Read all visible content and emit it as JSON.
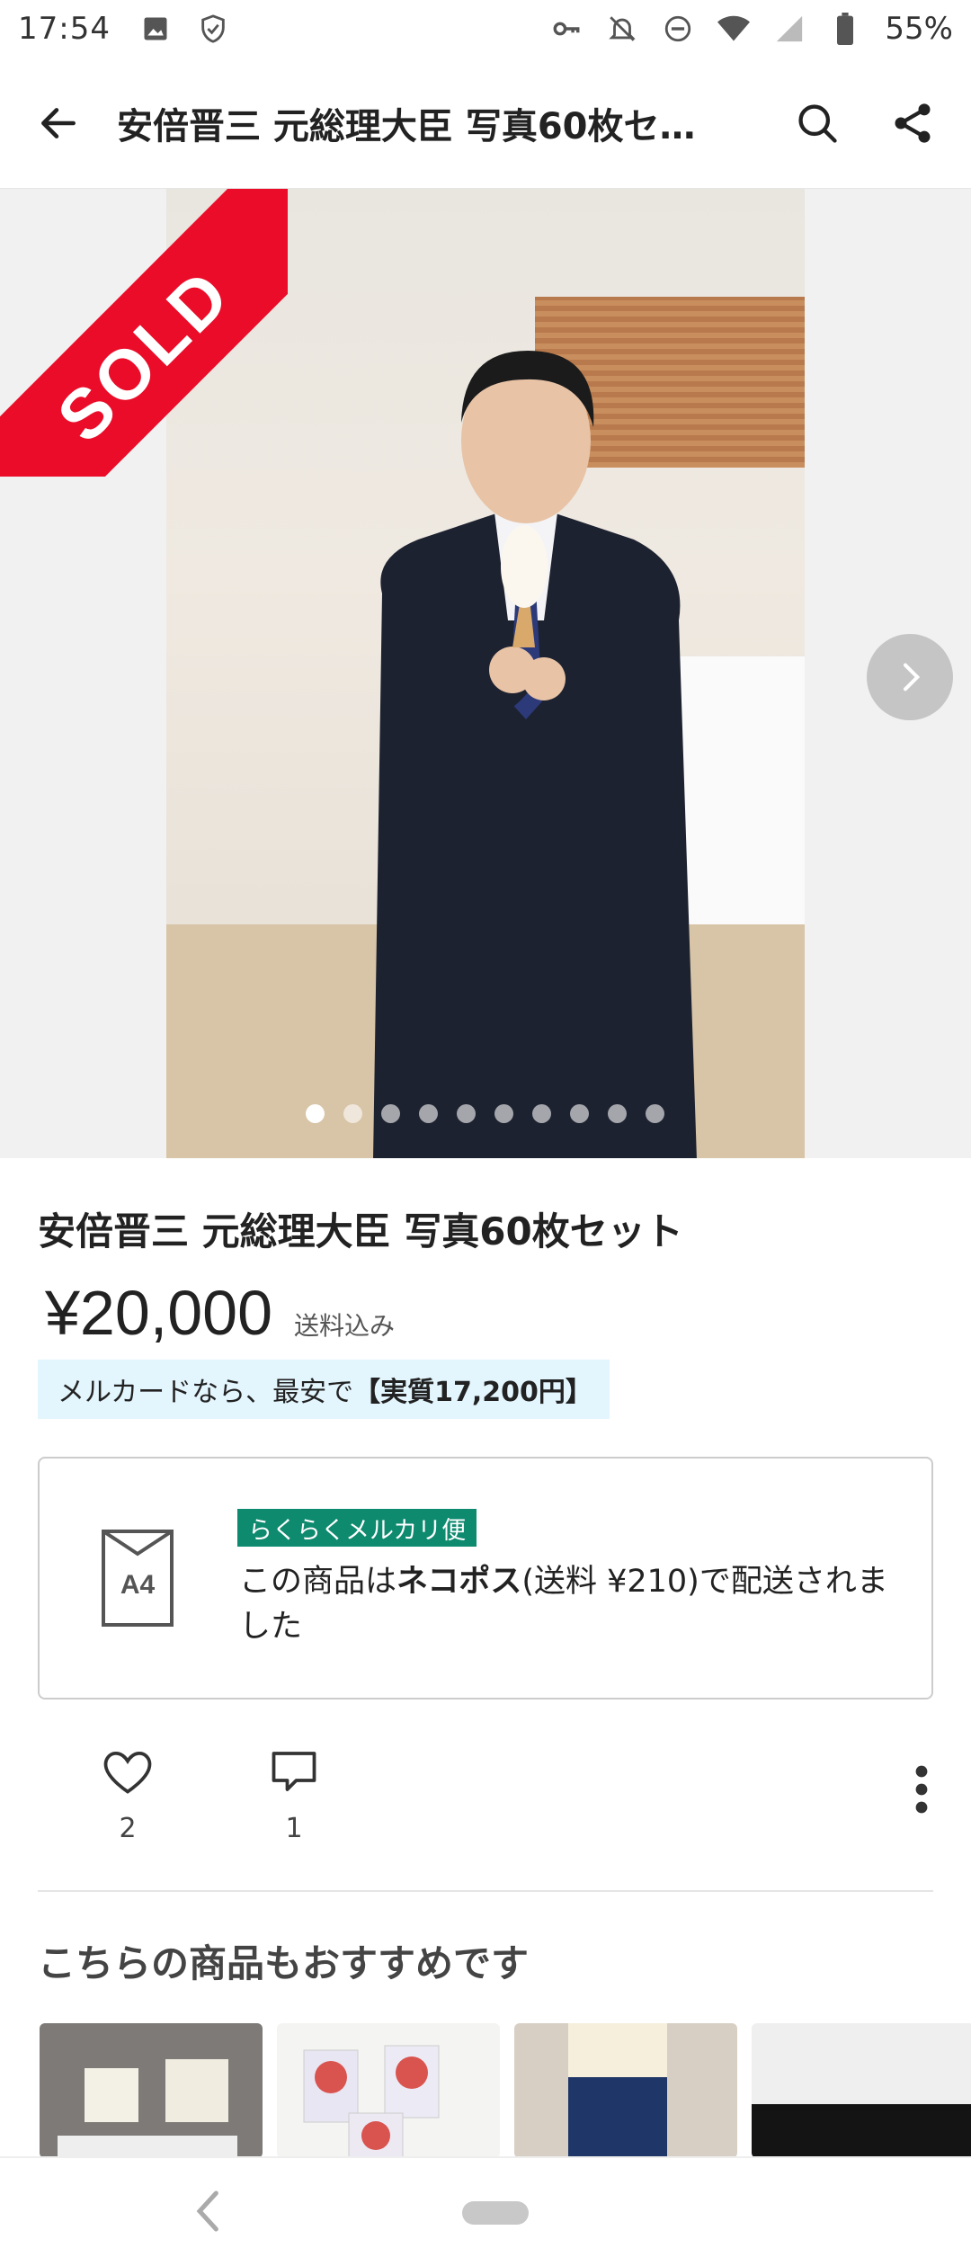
{
  "status_bar": {
    "time": "17:54",
    "battery": "55%"
  },
  "app_bar": {
    "title": "安倍晋三 元総理大臣 写真60枚セ…"
  },
  "hero": {
    "sold_label": "SOLD",
    "image_count": 10,
    "active_index": 0
  },
  "item": {
    "title": "安倍晋三 元総理大臣 写真60枚セット",
    "price": "¥20,000",
    "shipping_note": "送料込み",
    "mercard_prefix": "メルカードなら、最安で",
    "mercard_highlight": "【実質17,200円】"
  },
  "shipping": {
    "icon_label": "A4",
    "badge": "らくらくメルカリ便",
    "text_pre": "この商品は",
    "text_bold": "ネコポス",
    "text_post": "(送料 ¥210)で配送されました"
  },
  "actions": {
    "likes": "2",
    "comments": "1"
  },
  "recommendations": {
    "title": "こちらの商品もおすすめです"
  },
  "colors": {
    "sold_red": "#ea0c29",
    "badge_green": "#0e8a6f",
    "mercard_bg": "#e3f5fd"
  }
}
